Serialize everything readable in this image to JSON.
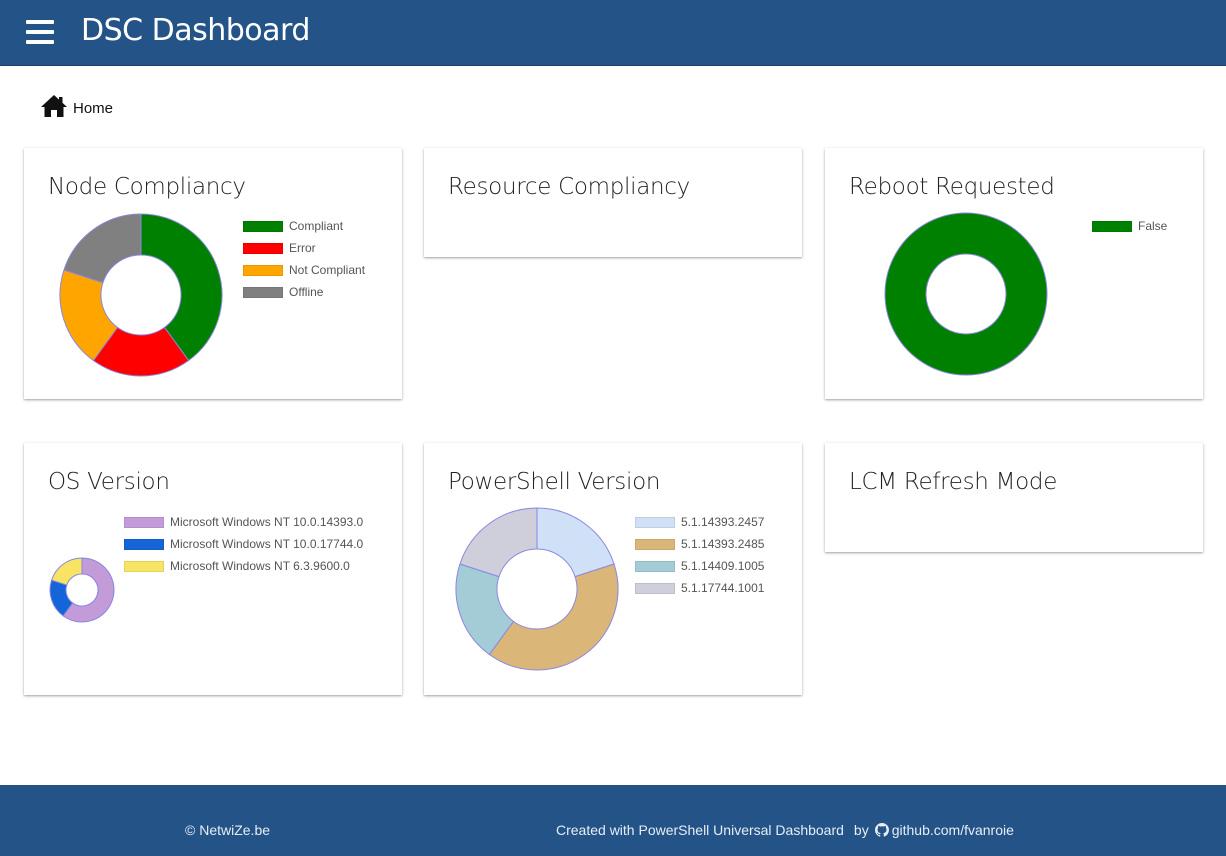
{
  "app": {
    "title": "DSC Dashboard"
  },
  "breadcrumb": {
    "home_label": "Home"
  },
  "cards": {
    "node_compliancy": {
      "title": "Node Compliancy"
    },
    "resource_compliancy": {
      "title": "Resource Compliancy"
    },
    "reboot_requested": {
      "title": "Reboot Requested"
    },
    "os_version": {
      "title": "OS Version"
    },
    "powershell_version": {
      "title": "PowerShell Version"
    },
    "lcm_refresh_mode": {
      "title": "LCM Refresh Mode"
    }
  },
  "chart_data": [
    {
      "id": "node_compliancy",
      "type": "pie",
      "title": "Node Compliancy",
      "categories": [
        "Compliant",
        "Error",
        "Not Compliant",
        "Offline"
      ],
      "values": [
        4,
        2,
        2,
        2
      ],
      "colors": [
        "#008000",
        "#ff0000",
        "#ffa500",
        "#808080"
      ],
      "legend_position": "right"
    },
    {
      "id": "reboot_requested",
      "type": "pie",
      "title": "Reboot Requested",
      "categories": [
        "False"
      ],
      "values": [
        1
      ],
      "colors": [
        "#008000"
      ],
      "legend_position": "top-right"
    },
    {
      "id": "os_version",
      "type": "pie",
      "title": "OS Version",
      "categories": [
        "Microsoft Windows NT 10.0.14393.0",
        "Microsoft Windows NT 10.0.17744.0",
        "Microsoft Windows NT 6.3.9600.0"
      ],
      "values": [
        6,
        2,
        2
      ],
      "colors": [
        "#c39bd9",
        "#1565d8",
        "#f7e463"
      ],
      "legend_position": "top-right"
    },
    {
      "id": "powershell_version",
      "type": "pie",
      "title": "PowerShell Version",
      "categories": [
        "5.1.14393.2457",
        "5.1.14393.2485",
        "5.1.14409.1005",
        "5.1.17744.1001"
      ],
      "values": [
        2,
        4,
        2,
        2
      ],
      "colors": [
        "#cfe0f7",
        "#dbb679",
        "#a3ccd6",
        "#cfcfdb"
      ],
      "legend_position": "right"
    }
  ],
  "footer": {
    "copyright": "© NetwiZe.be",
    "credit": "Created with PowerShell Universal Dashboard",
    "by": "by",
    "github_label": "github.com/fvanroie"
  },
  "colors": {
    "primary": "#245387"
  }
}
